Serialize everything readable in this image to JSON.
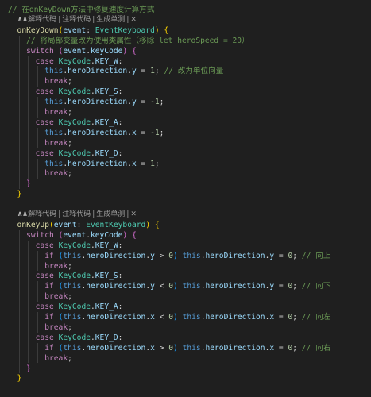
{
  "code_lens": {
    "parts": [
      "解释代码",
      "注释代码",
      "生成单测"
    ],
    "separator": "|",
    "close": "✕"
  },
  "editor": {
    "lines": [
      {
        "indent": 0,
        "tokens": [
          {
            "c": "com",
            "t": "// 在onKeyDown方法中修复速度计算方式"
          }
        ]
      },
      {
        "lens": true,
        "indent": 2
      },
      {
        "indent": 2,
        "tokens": [
          {
            "c": "fn",
            "t": "onKeyDown"
          },
          {
            "c": "br1",
            "t": "("
          },
          {
            "c": "var",
            "t": "event"
          },
          {
            "c": "op",
            "t": ": "
          },
          {
            "c": "type",
            "t": "EventKeyboard"
          },
          {
            "c": "br1",
            "t": ")"
          },
          {
            "c": "op",
            "t": " "
          },
          {
            "c": "br1",
            "t": "{"
          }
        ]
      },
      {
        "indent": 4,
        "tokens": [
          {
            "c": "com",
            "t": "// 将局部变量改为使用类属性（移除 let heroSpeed = 20）"
          }
        ]
      },
      {
        "indent": 4,
        "tokens": [
          {
            "c": "ctrl",
            "t": "switch"
          },
          {
            "c": "op",
            "t": " "
          },
          {
            "c": "br2",
            "t": "("
          },
          {
            "c": "var",
            "t": "event"
          },
          {
            "c": "op",
            "t": "."
          },
          {
            "c": "prop",
            "t": "keyCode"
          },
          {
            "c": "br2",
            "t": ")"
          },
          {
            "c": "op",
            "t": " "
          },
          {
            "c": "br2",
            "t": "{"
          }
        ]
      },
      {
        "indent": 6,
        "tokens": [
          {
            "c": "ctrl",
            "t": "case"
          },
          {
            "c": "op",
            "t": " "
          },
          {
            "c": "type",
            "t": "KeyCode"
          },
          {
            "c": "op",
            "t": "."
          },
          {
            "c": "prop",
            "t": "KEY_W"
          },
          {
            "c": "op",
            "t": ":"
          }
        ]
      },
      {
        "indent": 8,
        "tokens": [
          {
            "c": "kw",
            "t": "this"
          },
          {
            "c": "op",
            "t": "."
          },
          {
            "c": "prop",
            "t": "heroDirection"
          },
          {
            "c": "op",
            "t": "."
          },
          {
            "c": "prop",
            "t": "y"
          },
          {
            "c": "op",
            "t": " = "
          },
          {
            "c": "num",
            "t": "1"
          },
          {
            "c": "op",
            "t": "; "
          },
          {
            "c": "com",
            "t": "// 改为单位向量"
          }
        ]
      },
      {
        "indent": 8,
        "tokens": [
          {
            "c": "ctrl",
            "t": "break"
          },
          {
            "c": "op",
            "t": ";"
          }
        ]
      },
      {
        "indent": 6,
        "tokens": [
          {
            "c": "ctrl",
            "t": "case"
          },
          {
            "c": "op",
            "t": " "
          },
          {
            "c": "type",
            "t": "KeyCode"
          },
          {
            "c": "op",
            "t": "."
          },
          {
            "c": "prop",
            "t": "KEY_S"
          },
          {
            "c": "op",
            "t": ":"
          }
        ]
      },
      {
        "indent": 8,
        "tokens": [
          {
            "c": "kw",
            "t": "this"
          },
          {
            "c": "op",
            "t": "."
          },
          {
            "c": "prop",
            "t": "heroDirection"
          },
          {
            "c": "op",
            "t": "."
          },
          {
            "c": "prop",
            "t": "y"
          },
          {
            "c": "op",
            "t": " = "
          },
          {
            "c": "num",
            "t": "-1"
          },
          {
            "c": "op",
            "t": ";"
          }
        ]
      },
      {
        "indent": 8,
        "tokens": [
          {
            "c": "ctrl",
            "t": "break"
          },
          {
            "c": "op",
            "t": ";"
          }
        ]
      },
      {
        "indent": 6,
        "tokens": [
          {
            "c": "ctrl",
            "t": "case"
          },
          {
            "c": "op",
            "t": " "
          },
          {
            "c": "type",
            "t": "KeyCode"
          },
          {
            "c": "op",
            "t": "."
          },
          {
            "c": "prop",
            "t": "KEY_A"
          },
          {
            "c": "op",
            "t": ":"
          }
        ]
      },
      {
        "indent": 8,
        "tokens": [
          {
            "c": "kw",
            "t": "this"
          },
          {
            "c": "op",
            "t": "."
          },
          {
            "c": "prop",
            "t": "heroDirection"
          },
          {
            "c": "op",
            "t": "."
          },
          {
            "c": "prop",
            "t": "x"
          },
          {
            "c": "op",
            "t": " = "
          },
          {
            "c": "num",
            "t": "-1"
          },
          {
            "c": "op",
            "t": ";"
          }
        ]
      },
      {
        "indent": 8,
        "tokens": [
          {
            "c": "ctrl",
            "t": "break"
          },
          {
            "c": "op",
            "t": ";"
          }
        ]
      },
      {
        "indent": 6,
        "tokens": [
          {
            "c": "ctrl",
            "t": "case"
          },
          {
            "c": "op",
            "t": " "
          },
          {
            "c": "type",
            "t": "KeyCode"
          },
          {
            "c": "op",
            "t": "."
          },
          {
            "c": "prop",
            "t": "KEY_D"
          },
          {
            "c": "op",
            "t": ":"
          }
        ]
      },
      {
        "indent": 8,
        "tokens": [
          {
            "c": "kw",
            "t": "this"
          },
          {
            "c": "op",
            "t": "."
          },
          {
            "c": "prop",
            "t": "heroDirection"
          },
          {
            "c": "op",
            "t": "."
          },
          {
            "c": "prop",
            "t": "x"
          },
          {
            "c": "op",
            "t": " = "
          },
          {
            "c": "num",
            "t": "1"
          },
          {
            "c": "op",
            "t": ";"
          }
        ]
      },
      {
        "indent": 8,
        "tokens": [
          {
            "c": "ctrl",
            "t": "break"
          },
          {
            "c": "op",
            "t": ";"
          }
        ]
      },
      {
        "indent": 4,
        "tokens": [
          {
            "c": "br2",
            "t": "}"
          }
        ]
      },
      {
        "indent": 2,
        "tokens": [
          {
            "c": "br1",
            "t": "}"
          }
        ]
      },
      {
        "indent": 0,
        "tokens": []
      },
      {
        "lens": true,
        "indent": 2
      },
      {
        "indent": 2,
        "tokens": [
          {
            "c": "fn",
            "t": "onKeyUp"
          },
          {
            "c": "br1",
            "t": "("
          },
          {
            "c": "var",
            "t": "event"
          },
          {
            "c": "op",
            "t": ": "
          },
          {
            "c": "type",
            "t": "EventKeyboard"
          },
          {
            "c": "br1",
            "t": ")"
          },
          {
            "c": "op",
            "t": " "
          },
          {
            "c": "br1",
            "t": "{"
          }
        ]
      },
      {
        "indent": 4,
        "tokens": [
          {
            "c": "ctrl",
            "t": "switch"
          },
          {
            "c": "op",
            "t": " "
          },
          {
            "c": "br2",
            "t": "("
          },
          {
            "c": "var",
            "t": "event"
          },
          {
            "c": "op",
            "t": "."
          },
          {
            "c": "prop",
            "t": "keyCode"
          },
          {
            "c": "br2",
            "t": ")"
          },
          {
            "c": "op",
            "t": " "
          },
          {
            "c": "br2",
            "t": "{"
          }
        ]
      },
      {
        "indent": 6,
        "tokens": [
          {
            "c": "ctrl",
            "t": "case"
          },
          {
            "c": "op",
            "t": " "
          },
          {
            "c": "type",
            "t": "KeyCode"
          },
          {
            "c": "op",
            "t": "."
          },
          {
            "c": "prop",
            "t": "KEY_W"
          },
          {
            "c": "op",
            "t": ":"
          }
        ]
      },
      {
        "indent": 8,
        "tokens": [
          {
            "c": "ctrl",
            "t": "if"
          },
          {
            "c": "op",
            "t": " "
          },
          {
            "c": "br3",
            "t": "("
          },
          {
            "c": "kw",
            "t": "this"
          },
          {
            "c": "op",
            "t": "."
          },
          {
            "c": "prop",
            "t": "heroDirection"
          },
          {
            "c": "op",
            "t": "."
          },
          {
            "c": "prop",
            "t": "y"
          },
          {
            "c": "op",
            "t": " > "
          },
          {
            "c": "num",
            "t": "0"
          },
          {
            "c": "br3",
            "t": ")"
          },
          {
            "c": "op",
            "t": " "
          },
          {
            "c": "kw",
            "t": "this"
          },
          {
            "c": "op",
            "t": "."
          },
          {
            "c": "prop",
            "t": "heroDirection"
          },
          {
            "c": "op",
            "t": "."
          },
          {
            "c": "prop",
            "t": "y"
          },
          {
            "c": "op",
            "t": " = "
          },
          {
            "c": "num",
            "t": "0"
          },
          {
            "c": "op",
            "t": "; "
          },
          {
            "c": "com",
            "t": "// 向上"
          }
        ]
      },
      {
        "indent": 8,
        "tokens": [
          {
            "c": "ctrl",
            "t": "break"
          },
          {
            "c": "op",
            "t": ";"
          }
        ]
      },
      {
        "indent": 6,
        "tokens": [
          {
            "c": "ctrl",
            "t": "case"
          },
          {
            "c": "op",
            "t": " "
          },
          {
            "c": "type",
            "t": "KeyCode"
          },
          {
            "c": "op",
            "t": "."
          },
          {
            "c": "prop",
            "t": "KEY_S"
          },
          {
            "c": "op",
            "t": ":"
          }
        ]
      },
      {
        "indent": 8,
        "tokens": [
          {
            "c": "ctrl",
            "t": "if"
          },
          {
            "c": "op",
            "t": " "
          },
          {
            "c": "br3",
            "t": "("
          },
          {
            "c": "kw",
            "t": "this"
          },
          {
            "c": "op",
            "t": "."
          },
          {
            "c": "prop",
            "t": "heroDirection"
          },
          {
            "c": "op",
            "t": "."
          },
          {
            "c": "prop",
            "t": "y"
          },
          {
            "c": "op",
            "t": " < "
          },
          {
            "c": "num",
            "t": "0"
          },
          {
            "c": "br3",
            "t": ")"
          },
          {
            "c": "op",
            "t": " "
          },
          {
            "c": "kw",
            "t": "this"
          },
          {
            "c": "op",
            "t": "."
          },
          {
            "c": "prop",
            "t": "heroDirection"
          },
          {
            "c": "op",
            "t": "."
          },
          {
            "c": "prop",
            "t": "y"
          },
          {
            "c": "op",
            "t": " = "
          },
          {
            "c": "num",
            "t": "0"
          },
          {
            "c": "op",
            "t": "; "
          },
          {
            "c": "com",
            "t": "// 向下"
          }
        ]
      },
      {
        "indent": 8,
        "tokens": [
          {
            "c": "ctrl",
            "t": "break"
          },
          {
            "c": "op",
            "t": ";"
          }
        ]
      },
      {
        "indent": 6,
        "tokens": [
          {
            "c": "ctrl",
            "t": "case"
          },
          {
            "c": "op",
            "t": " "
          },
          {
            "c": "type",
            "t": "KeyCode"
          },
          {
            "c": "op",
            "t": "."
          },
          {
            "c": "prop",
            "t": "KEY_A"
          },
          {
            "c": "op",
            "t": ":"
          }
        ]
      },
      {
        "indent": 8,
        "tokens": [
          {
            "c": "ctrl",
            "t": "if"
          },
          {
            "c": "op",
            "t": " "
          },
          {
            "c": "br3",
            "t": "("
          },
          {
            "c": "kw",
            "t": "this"
          },
          {
            "c": "op",
            "t": "."
          },
          {
            "c": "prop",
            "t": "heroDirection"
          },
          {
            "c": "op",
            "t": "."
          },
          {
            "c": "prop",
            "t": "x"
          },
          {
            "c": "op",
            "t": " < "
          },
          {
            "c": "num",
            "t": "0"
          },
          {
            "c": "br3",
            "t": ")"
          },
          {
            "c": "op",
            "t": " "
          },
          {
            "c": "kw",
            "t": "this"
          },
          {
            "c": "op",
            "t": "."
          },
          {
            "c": "prop",
            "t": "heroDirection"
          },
          {
            "c": "op",
            "t": "."
          },
          {
            "c": "prop",
            "t": "x"
          },
          {
            "c": "op",
            "t": " = "
          },
          {
            "c": "num",
            "t": "0"
          },
          {
            "c": "op",
            "t": "; "
          },
          {
            "c": "com",
            "t": "// 向左"
          }
        ]
      },
      {
        "indent": 8,
        "tokens": [
          {
            "c": "ctrl",
            "t": "break"
          },
          {
            "c": "op",
            "t": ";"
          }
        ]
      },
      {
        "indent": 6,
        "tokens": [
          {
            "c": "ctrl",
            "t": "case"
          },
          {
            "c": "op",
            "t": " "
          },
          {
            "c": "type",
            "t": "KeyCode"
          },
          {
            "c": "op",
            "t": "."
          },
          {
            "c": "prop",
            "t": "KEY_D"
          },
          {
            "c": "op",
            "t": ":"
          }
        ]
      },
      {
        "indent": 8,
        "tokens": [
          {
            "c": "ctrl",
            "t": "if"
          },
          {
            "c": "op",
            "t": " "
          },
          {
            "c": "br3",
            "t": "("
          },
          {
            "c": "kw",
            "t": "this"
          },
          {
            "c": "op",
            "t": "."
          },
          {
            "c": "prop",
            "t": "heroDirection"
          },
          {
            "c": "op",
            "t": "."
          },
          {
            "c": "prop",
            "t": "x"
          },
          {
            "c": "op",
            "t": " > "
          },
          {
            "c": "num",
            "t": "0"
          },
          {
            "c": "br3",
            "t": ")"
          },
          {
            "c": "op",
            "t": " "
          },
          {
            "c": "kw",
            "t": "this"
          },
          {
            "c": "op",
            "t": "."
          },
          {
            "c": "prop",
            "t": "heroDirection"
          },
          {
            "c": "op",
            "t": "."
          },
          {
            "c": "prop",
            "t": "x"
          },
          {
            "c": "op",
            "t": " = "
          },
          {
            "c": "num",
            "t": "0"
          },
          {
            "c": "op",
            "t": "; "
          },
          {
            "c": "com",
            "t": "// 向右"
          }
        ]
      },
      {
        "indent": 8,
        "tokens": [
          {
            "c": "ctrl",
            "t": "break"
          },
          {
            "c": "op",
            "t": ";"
          }
        ]
      },
      {
        "indent": 4,
        "tokens": [
          {
            "c": "br2",
            "t": "}"
          }
        ]
      },
      {
        "indent": 2,
        "tokens": [
          {
            "c": "br1",
            "t": "}"
          }
        ]
      }
    ]
  }
}
